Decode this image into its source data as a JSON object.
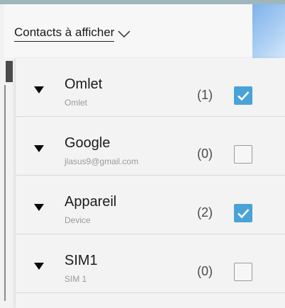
{
  "filter": {
    "label": "Contacts à afficher"
  },
  "accounts": [
    {
      "name": "Omlet",
      "detail": "Omlet",
      "count": "(1)",
      "checked": true
    },
    {
      "name": "Google",
      "detail": "jlasus9@gmail.com",
      "count": "(0)",
      "checked": false
    },
    {
      "name": "Appareil",
      "detail": "Device",
      "count": "(2)",
      "checked": true
    },
    {
      "name": "SIM1",
      "detail": "SIM 1",
      "count": "(0)",
      "checked": false
    }
  ],
  "colors": {
    "accent": "#4aa3d7"
  }
}
